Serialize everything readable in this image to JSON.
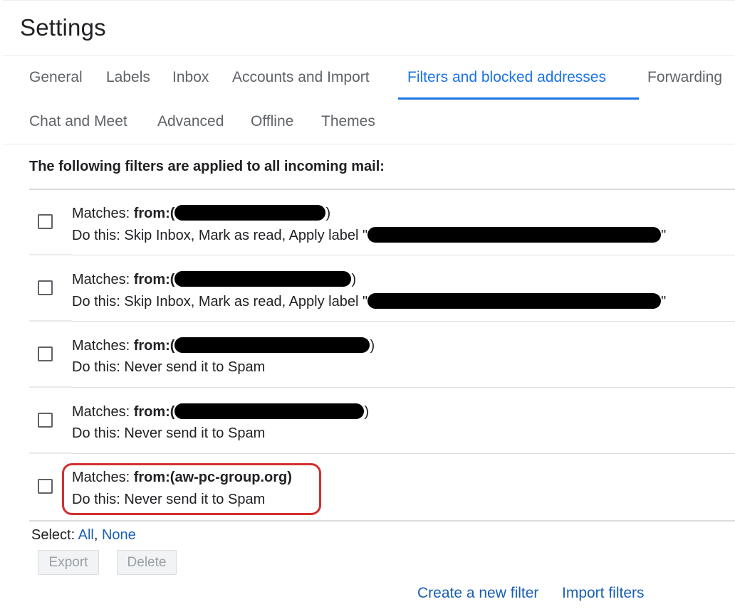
{
  "page_title": "Settings",
  "tabs": [
    {
      "label": "General"
    },
    {
      "label": "Labels"
    },
    {
      "label": "Inbox"
    },
    {
      "label": "Accounts and Import"
    },
    {
      "label": "Filters and blocked addresses",
      "active": true
    },
    {
      "label": "Forwarding"
    },
    {
      "label": "Chat and Meet"
    },
    {
      "label": "Advanced"
    },
    {
      "label": "Offline"
    },
    {
      "label": "Themes"
    }
  ],
  "filters_heading": "The following filters are applied to all incoming mail:",
  "filters": [
    {
      "matches_prefix": "Matches: ",
      "criteria_label": "from:(",
      "criteria_value": "",
      "criteria_close": ")",
      "action": "Do this: Skip Inbox, Mark as read, Apply label \"",
      "action_close": "\""
    },
    {
      "matches_prefix": "Matches: ",
      "criteria_label": "from:(",
      "criteria_value": "",
      "criteria_close": ")",
      "action": "Do this: Skip Inbox, Mark as read, Apply label \"",
      "action_close": "\""
    },
    {
      "matches_prefix": "Matches: ",
      "criteria_label": "from:(",
      "criteria_value": "",
      "criteria_close": ")",
      "action": "Do this: Never send it to Spam"
    },
    {
      "matches_prefix": "Matches: ",
      "criteria_label": "from:(",
      "criteria_value": "",
      "criteria_close": ")",
      "action": "Do this: Never send it to Spam"
    },
    {
      "matches_prefix": "Matches: ",
      "criteria_label": "from:(",
      "criteria_value": "aw-pc-group.org",
      "criteria_close": ")",
      "action": "Do this: Never send it to Spam"
    }
  ],
  "select": {
    "label": "Select: ",
    "all": "All",
    "separator": ", ",
    "none": "None"
  },
  "buttons": {
    "export": "Export",
    "delete": "Delete"
  },
  "links": {
    "create_filter": "Create a new filter",
    "import_filters": "Import filters"
  },
  "colors": {
    "accent": "#1a73e8",
    "link": "#1a5fb4",
    "highlight": "#d32f2f"
  }
}
